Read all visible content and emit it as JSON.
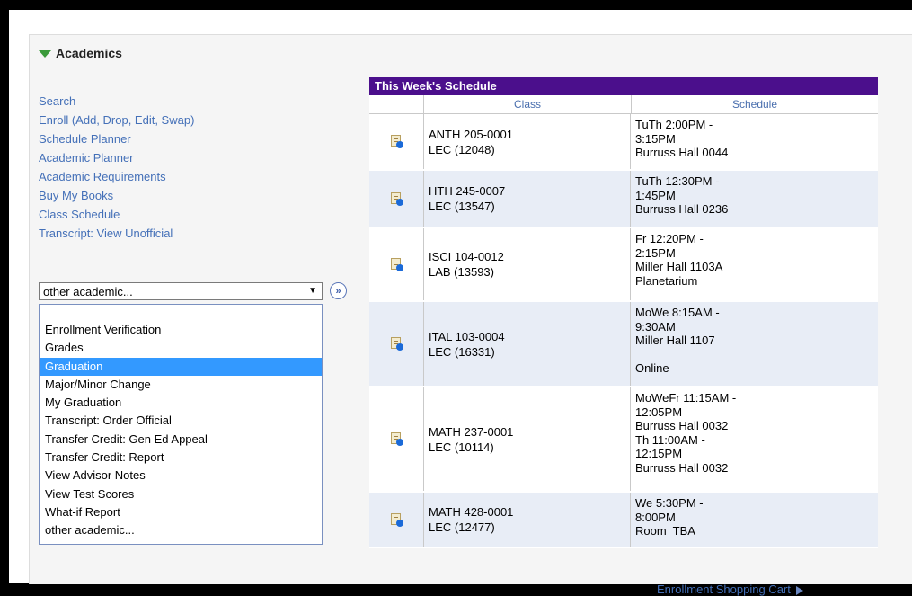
{
  "section": {
    "title": "Academics"
  },
  "links": [
    "Search",
    "Enroll (Add, Drop, Edit, Swap)",
    "Schedule Planner",
    "Academic Planner",
    "Academic Requirements",
    "Buy My Books",
    "Class Schedule",
    "Transcript: View Unofficial"
  ],
  "select": {
    "value": "other academic...",
    "go_icon": "double-chevron-right-icon"
  },
  "dropdown_options": [
    {
      "label": "Enrollment Verification",
      "selected": false
    },
    {
      "label": "Grades",
      "selected": false
    },
    {
      "label": "Graduation",
      "selected": true
    },
    {
      "label": "Major/Minor Change",
      "selected": false
    },
    {
      "label": "My Graduation",
      "selected": false
    },
    {
      "label": "Transcript: Order Official",
      "selected": false
    },
    {
      "label": "Transfer Credit: Gen Ed Appeal",
      "selected": false
    },
    {
      "label": "Transfer Credit: Report",
      "selected": false
    },
    {
      "label": "View Advisor Notes",
      "selected": false
    },
    {
      "label": "View Test Scores",
      "selected": false
    },
    {
      "label": "What-if Report",
      "selected": false
    },
    {
      "label": "other academic...",
      "selected": false
    }
  ],
  "schedule": {
    "title": "This Week's Schedule",
    "col_class": "Class",
    "col_schedule": "Schedule",
    "rows": [
      {
        "course": "ANTH 205-0001",
        "section": "LEC (12048)",
        "schedule": [
          "TuTh 2:00PM -",
          "3:15PM",
          "Burruss Hall 0044"
        ]
      },
      {
        "course": "HTH 245-0007",
        "section": "LEC (13547)",
        "schedule": [
          "TuTh 12:30PM -",
          "1:45PM",
          "Burruss Hall 0236"
        ]
      },
      {
        "course": "ISCI 104-0012",
        "section": "LAB (13593)",
        "schedule": [
          "Fr 12:20PM -",
          "2:15PM",
          "Miller Hall 1103A",
          "Planetarium"
        ]
      },
      {
        "course": "ITAL 103-0004",
        "section": "LEC (16331)",
        "schedule": [
          "MoWe 8:15AM -",
          "9:30AM",
          "Miller Hall 1107",
          "",
          "Online"
        ]
      },
      {
        "course": "MATH 237-0001",
        "section": "LEC (10114)",
        "schedule": [
          "MoWeFr 11:15AM -",
          "12:05PM",
          "Burruss Hall 0032",
          "Th 11:00AM -",
          "12:15PM",
          "Burruss Hall 0032"
        ]
      },
      {
        "course": "MATH 428-0001",
        "section": "LEC (12477)",
        "schedule": [
          "We 5:30PM -",
          "8:00PM",
          "Room  TBA"
        ]
      }
    ]
  },
  "cart_link": "Enrollment Shopping Cart",
  "colors": {
    "header_purple": "#4b0f8c",
    "link_blue": "#4470b8",
    "selection_blue": "#3399ff",
    "alt_row": "#e8edf6"
  }
}
